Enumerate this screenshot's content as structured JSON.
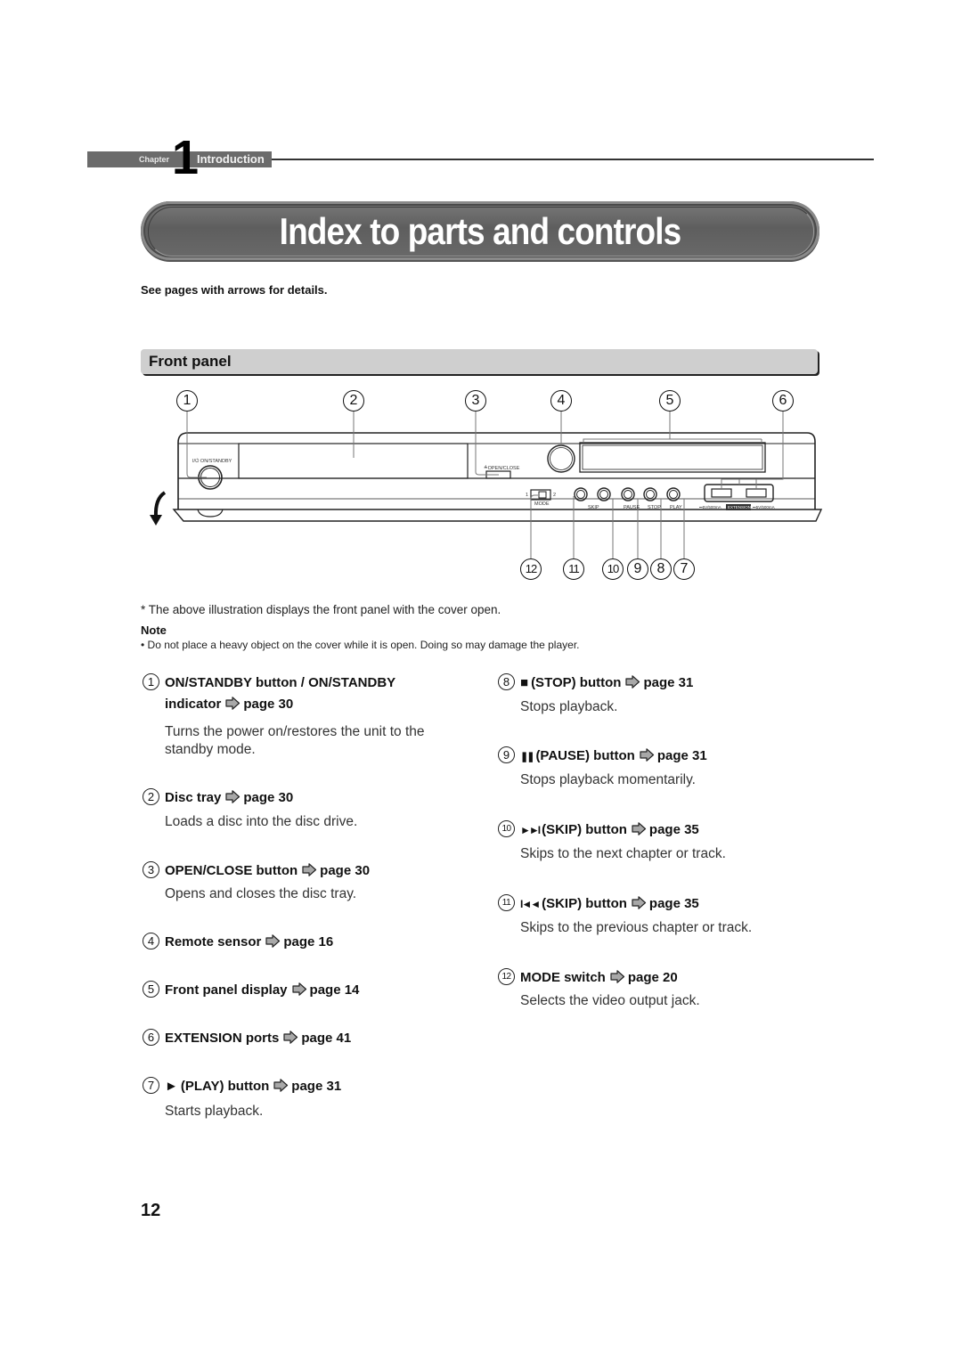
{
  "chapter": {
    "label": "Chapter",
    "number": "1",
    "title": "Introduction"
  },
  "page_title": "Index to parts and controls",
  "intro": "See pages with arrows for details.",
  "section": {
    "title": "Front panel"
  },
  "diagram": {
    "top_callouts": [
      "1",
      "2",
      "3",
      "4",
      "5",
      "6"
    ],
    "bottom_callouts": [
      "12",
      "11",
      "10",
      "9",
      "8",
      "7"
    ],
    "labels": {
      "standby": "I/⏻ ON/STANDBY",
      "open_close": "≜OPEN/CLOSE",
      "mode": "MODE",
      "mode_1": "1",
      "mode_2": "2",
      "skip": "SKIP",
      "pause": "PAUSE",
      "stop": "STOP",
      "play": "PLAY",
      "extension": "EXTENSION",
      "port_rating_left": "⎓5V/500mA",
      "port_rating_right": "⎓5V/500mA"
    }
  },
  "footnote": "* The above illustration displays the front panel with the cover open.",
  "note": {
    "title": "Note",
    "text": "• Do not place a heavy object on the cover while it is open. Doing so may damage the player."
  },
  "items": [
    {
      "num": "1",
      "glyph": "",
      "name_line1": "ON/STANDBY button / ON/STANDBY",
      "name": "indicator",
      "page": "page 30",
      "desc": "Turns the power on/restores the unit to the standby mode."
    },
    {
      "num": "2",
      "glyph": "",
      "name": "Disc tray",
      "page": "page 30",
      "desc": "Loads a disc into the disc drive."
    },
    {
      "num": "3",
      "glyph": "",
      "name": "OPEN/CLOSE button",
      "page": "page 30",
      "desc": "Opens and closes the disc tray."
    },
    {
      "num": "4",
      "glyph": "",
      "name": "Remote sensor",
      "page": "page 16",
      "desc": ""
    },
    {
      "num": "5",
      "glyph": "",
      "name": "Front panel display",
      "page": "page 14",
      "desc": ""
    },
    {
      "num": "6",
      "glyph": "",
      "name": "EXTENSION ports",
      "page": "page 41",
      "desc": ""
    },
    {
      "num": "7",
      "glyph": "►",
      "name": "(PLAY) button",
      "page": "page 31",
      "desc": "Starts playback."
    },
    {
      "num": "8",
      "glyph": "■",
      "name": "(STOP) button",
      "page": "page 31",
      "desc": "Stops playback."
    },
    {
      "num": "9",
      "glyph": "❚❚",
      "name": "(PAUSE) button",
      "page": "page 31",
      "desc": "Stops playback momentarily."
    },
    {
      "num": "10",
      "glyph": "►►I",
      "name": "(SKIP) button",
      "page": "page 35",
      "desc": "Skips to the next chapter or track."
    },
    {
      "num": "11",
      "glyph": "I◄◄",
      "name": "(SKIP) button",
      "page": "page 35",
      "desc": "Skips to the previous chapter or track."
    },
    {
      "num": "12",
      "glyph": "",
      "name": "MODE switch",
      "page": "page 20",
      "desc": "Selects the video output jack."
    }
  ],
  "page_number": "12"
}
